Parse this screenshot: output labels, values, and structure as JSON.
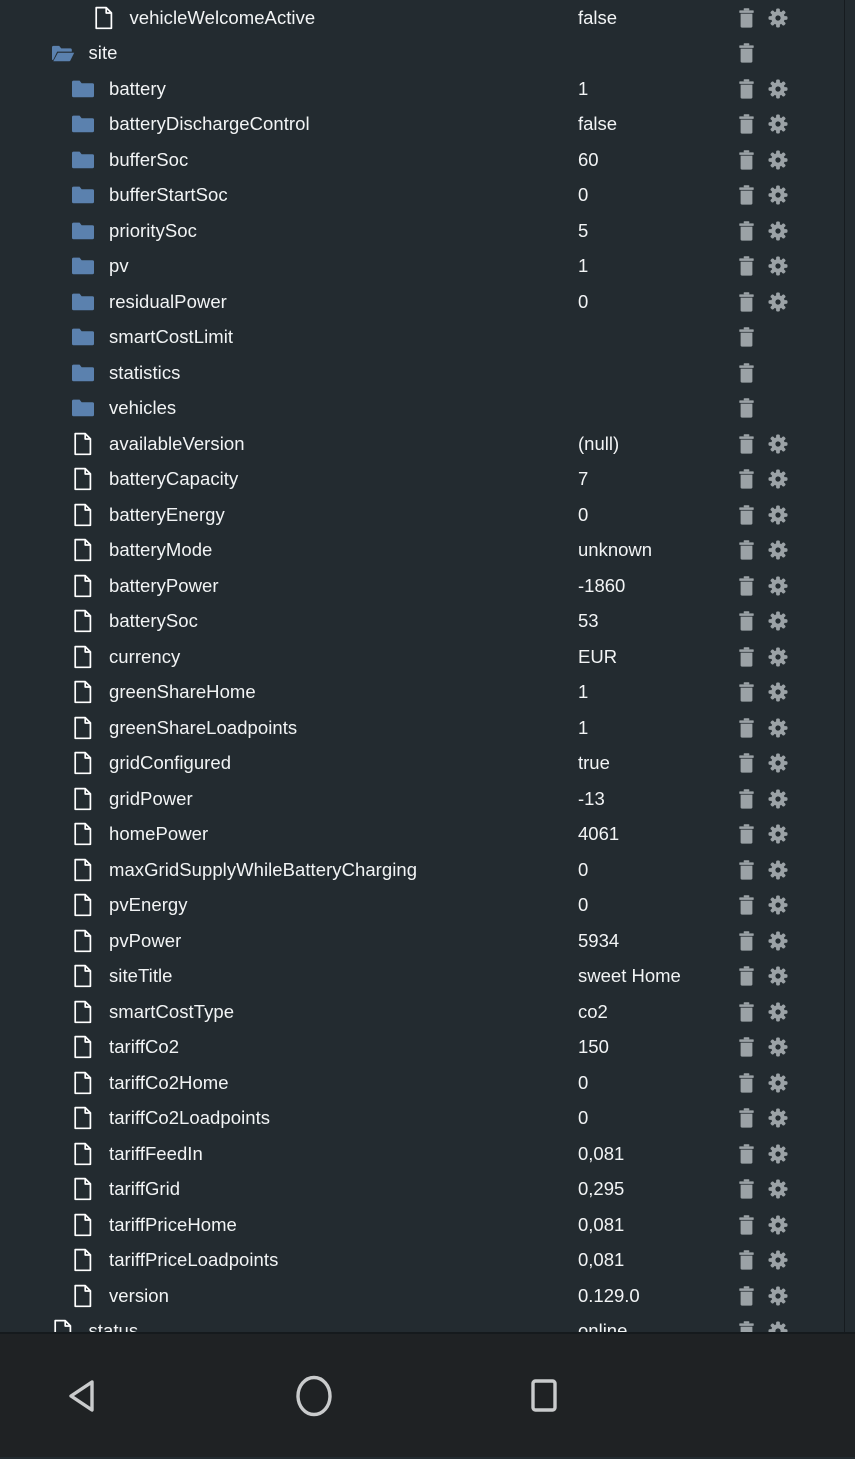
{
  "colors": {
    "background": "#232b30",
    "navbar_background": "#1f2224",
    "text": "#f2f4f5",
    "folder_icon": "#5b81ae",
    "file_icon": "#ffffff",
    "action_icon": "#9ba2a6",
    "divider": "#151a1d"
  },
  "tree": {
    "rows": [
      {
        "name": "vehicleWelcomeActive",
        "value": "false",
        "icon": "file-icon",
        "depth": 3,
        "delete": true,
        "settings": true
      },
      {
        "name": "site",
        "value": "",
        "icon": "folder-open-icon",
        "depth": 1,
        "delete": true,
        "settings": false
      },
      {
        "name": "battery",
        "value": "1",
        "icon": "folder-icon",
        "depth": 2,
        "delete": true,
        "settings": true
      },
      {
        "name": "batteryDischargeControl",
        "value": "false",
        "icon": "folder-icon",
        "depth": 2,
        "delete": true,
        "settings": true
      },
      {
        "name": "bufferSoc",
        "value": "60",
        "icon": "folder-icon",
        "depth": 2,
        "delete": true,
        "settings": true
      },
      {
        "name": "bufferStartSoc",
        "value": "0",
        "icon": "folder-icon",
        "depth": 2,
        "delete": true,
        "settings": true
      },
      {
        "name": "prioritySoc",
        "value": "5",
        "icon": "folder-icon",
        "depth": 2,
        "delete": true,
        "settings": true
      },
      {
        "name": "pv",
        "value": "1",
        "icon": "folder-icon",
        "depth": 2,
        "delete": true,
        "settings": true
      },
      {
        "name": "residualPower",
        "value": "0",
        "icon": "folder-icon",
        "depth": 2,
        "delete": true,
        "settings": true
      },
      {
        "name": "smartCostLimit",
        "value": "",
        "icon": "folder-icon",
        "depth": 2,
        "delete": true,
        "settings": false
      },
      {
        "name": "statistics",
        "value": "",
        "icon": "folder-icon",
        "depth": 2,
        "delete": true,
        "settings": false
      },
      {
        "name": "vehicles",
        "value": "",
        "icon": "folder-icon",
        "depth": 2,
        "delete": true,
        "settings": false
      },
      {
        "name": "availableVersion",
        "value": "(null)",
        "icon": "file-icon",
        "depth": 2,
        "delete": true,
        "settings": true
      },
      {
        "name": "batteryCapacity",
        "value": "7",
        "icon": "file-icon",
        "depth": 2,
        "delete": true,
        "settings": true
      },
      {
        "name": "batteryEnergy",
        "value": "0",
        "icon": "file-icon",
        "depth": 2,
        "delete": true,
        "settings": true
      },
      {
        "name": "batteryMode",
        "value": "unknown",
        "icon": "file-icon",
        "depth": 2,
        "delete": true,
        "settings": true
      },
      {
        "name": "batteryPower",
        "value": "-1860",
        "icon": "file-icon",
        "depth": 2,
        "delete": true,
        "settings": true
      },
      {
        "name": "batterySoc",
        "value": "53",
        "icon": "file-icon",
        "depth": 2,
        "delete": true,
        "settings": true
      },
      {
        "name": "currency",
        "value": "EUR",
        "icon": "file-icon",
        "depth": 2,
        "delete": true,
        "settings": true
      },
      {
        "name": "greenShareHome",
        "value": "1",
        "icon": "file-icon",
        "depth": 2,
        "delete": true,
        "settings": true
      },
      {
        "name": "greenShareLoadpoints",
        "value": "1",
        "icon": "file-icon",
        "depth": 2,
        "delete": true,
        "settings": true
      },
      {
        "name": "gridConfigured",
        "value": "true",
        "icon": "file-icon",
        "depth": 2,
        "delete": true,
        "settings": true
      },
      {
        "name": "gridPower",
        "value": "-13",
        "icon": "file-icon",
        "depth": 2,
        "delete": true,
        "settings": true
      },
      {
        "name": "homePower",
        "value": "4061",
        "icon": "file-icon",
        "depth": 2,
        "delete": true,
        "settings": true
      },
      {
        "name": "maxGridSupplyWhileBatteryCharging",
        "value": "0",
        "icon": "file-icon",
        "depth": 2,
        "delete": true,
        "settings": true
      },
      {
        "name": "pvEnergy",
        "value": "0",
        "icon": "file-icon",
        "depth": 2,
        "delete": true,
        "settings": true
      },
      {
        "name": "pvPower",
        "value": "5934",
        "icon": "file-icon",
        "depth": 2,
        "delete": true,
        "settings": true
      },
      {
        "name": "siteTitle",
        "value": "sweet Home",
        "icon": "file-icon",
        "depth": 2,
        "delete": true,
        "settings": true
      },
      {
        "name": "smartCostType",
        "value": "co2",
        "icon": "file-icon",
        "depth": 2,
        "delete": true,
        "settings": true
      },
      {
        "name": "tariffCo2",
        "value": "150",
        "icon": "file-icon",
        "depth": 2,
        "delete": true,
        "settings": true
      },
      {
        "name": "tariffCo2Home",
        "value": "0",
        "icon": "file-icon",
        "depth": 2,
        "delete": true,
        "settings": true
      },
      {
        "name": "tariffCo2Loadpoints",
        "value": "0",
        "icon": "file-icon",
        "depth": 2,
        "delete": true,
        "settings": true
      },
      {
        "name": "tariffFeedIn",
        "value": "0,081",
        "icon": "file-icon",
        "depth": 2,
        "delete": true,
        "settings": true
      },
      {
        "name": "tariffGrid",
        "value": "0,295",
        "icon": "file-icon",
        "depth": 2,
        "delete": true,
        "settings": true
      },
      {
        "name": "tariffPriceHome",
        "value": "0,081",
        "icon": "file-icon",
        "depth": 2,
        "delete": true,
        "settings": true
      },
      {
        "name": "tariffPriceLoadpoints",
        "value": "0,081",
        "icon": "file-icon",
        "depth": 2,
        "delete": true,
        "settings": true
      },
      {
        "name": "version",
        "value": "0.129.0",
        "icon": "file-icon",
        "depth": 2,
        "delete": true,
        "settings": true
      },
      {
        "name": "status",
        "value": "online",
        "icon": "file-icon",
        "depth": 1,
        "delete": true,
        "settings": true
      }
    ]
  },
  "navbar": {
    "buttons": [
      {
        "name": "back",
        "icon": "back-triangle-icon"
      },
      {
        "name": "home",
        "icon": "home-circle-icon"
      },
      {
        "name": "recents",
        "icon": "recents-square-icon"
      }
    ]
  }
}
